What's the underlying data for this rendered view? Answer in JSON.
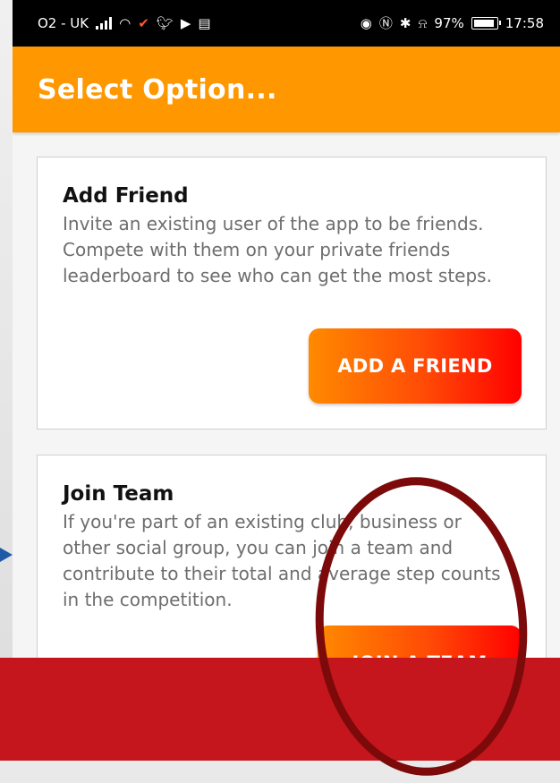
{
  "status_bar": {
    "carrier": "O2 - UK",
    "battery_percent": "97%",
    "time": "17:58",
    "battery_level": 0.97,
    "left_icons": [
      "signal-icon",
      "wifi-icon",
      "bird-notification-icon",
      "twitter-icon",
      "youtube-icon",
      "calendar-icon"
    ],
    "right_icons": [
      "eye-icon",
      "nfc-icon",
      "bluetooth-icon",
      "mute-bell-icon",
      "battery-icon"
    ]
  },
  "app_bar": {
    "title": "Select Option..."
  },
  "cards": [
    {
      "title": "Add Friend",
      "description": "Invite an existing user of the app to be friends. Compete with them on your private friends leaderboard to see who can get the most steps.",
      "button_label": "ADD A FRIEND"
    },
    {
      "title": "Join Team",
      "description": "If you're part of an existing club, business or other social group, you can join a team and contribute to their total and average step counts in the competition.",
      "button_label": "JOIN A TEAM"
    }
  ],
  "colors": {
    "app_bar": "#ff9800",
    "button_gradient_start": "#ff8a00",
    "button_gradient_end": "#ff0000",
    "annotation_circle": "#7d0a0a"
  }
}
